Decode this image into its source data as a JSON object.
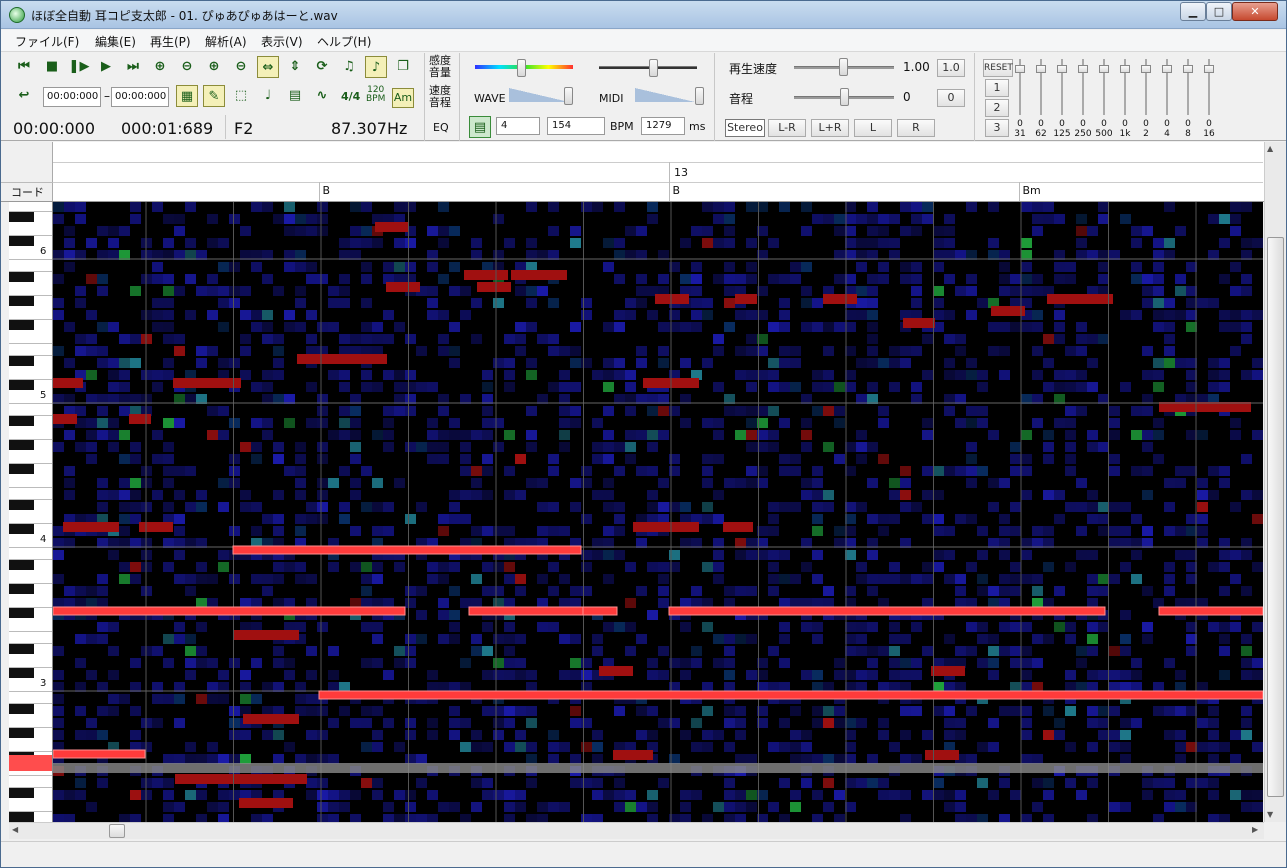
{
  "window": {
    "title": "ほぼ全自動 耳コピ支太郎 - 01. ぴゅあぴゅあはーと.wav"
  },
  "menu": [
    "ファイル(F)",
    "編集(E)",
    "再生(P)",
    "解析(A)",
    "表示(V)",
    "ヘルプ(H)"
  ],
  "toolbar": {
    "start_time": "00:00:000",
    "dash": "–",
    "end_time": "00:00:000",
    "time_sig": "4/4",
    "bpm_icon": "120\nBPM",
    "am_icon": "Am",
    "current_time": "00:00:000",
    "total_time": "000:01:689",
    "note_name": "F2",
    "frequency": "87.307Hz"
  },
  "params": {
    "sensitivity_label": "感度\n音量",
    "speed_label": "速度\n音程",
    "eq_label": "EQ",
    "wave_label": "WAVE",
    "midi_label": "MIDI",
    "beats_value": "4",
    "bpm_value": "154",
    "bpm_label": "BPM",
    "ms_value": "1279",
    "ms_label": "ms"
  },
  "playback": {
    "speed_label": "再生速度",
    "speed_value": "1.00",
    "speed_reset": "1.0",
    "pitch_label": "音程",
    "pitch_value": "0",
    "pitch_reset": "0",
    "channel_buttons": [
      "Stereo",
      "L-R",
      "L+R",
      "L",
      "R"
    ]
  },
  "equalizer": {
    "reset_label": "RESET",
    "presets": [
      "1",
      "2",
      "3"
    ],
    "values": [
      "0",
      "0",
      "0",
      "0",
      "0",
      "0",
      "0",
      "0",
      "0",
      "0"
    ],
    "freqs": [
      "31",
      "62",
      "125",
      "250",
      "500",
      "1k",
      "2",
      "4",
      "8",
      "16"
    ]
  },
  "ruler": {
    "measure_number": "13",
    "chord_row_label": "コード",
    "chords": [
      {
        "label": "B",
        "beat": 3
      },
      {
        "label": "B",
        "beat": 7
      },
      {
        "label": "Bm",
        "beat": 11
      }
    ]
  },
  "piano": {
    "octave_labels": [
      "6",
      "5",
      "4",
      "3"
    ]
  },
  "colors": {
    "note_red": "#ff3b3b",
    "spectral_dark_red": "#a01010",
    "spectral_blue": "#1a1a9a",
    "spectral_green": "#1fa03a",
    "background": "#000000"
  }
}
